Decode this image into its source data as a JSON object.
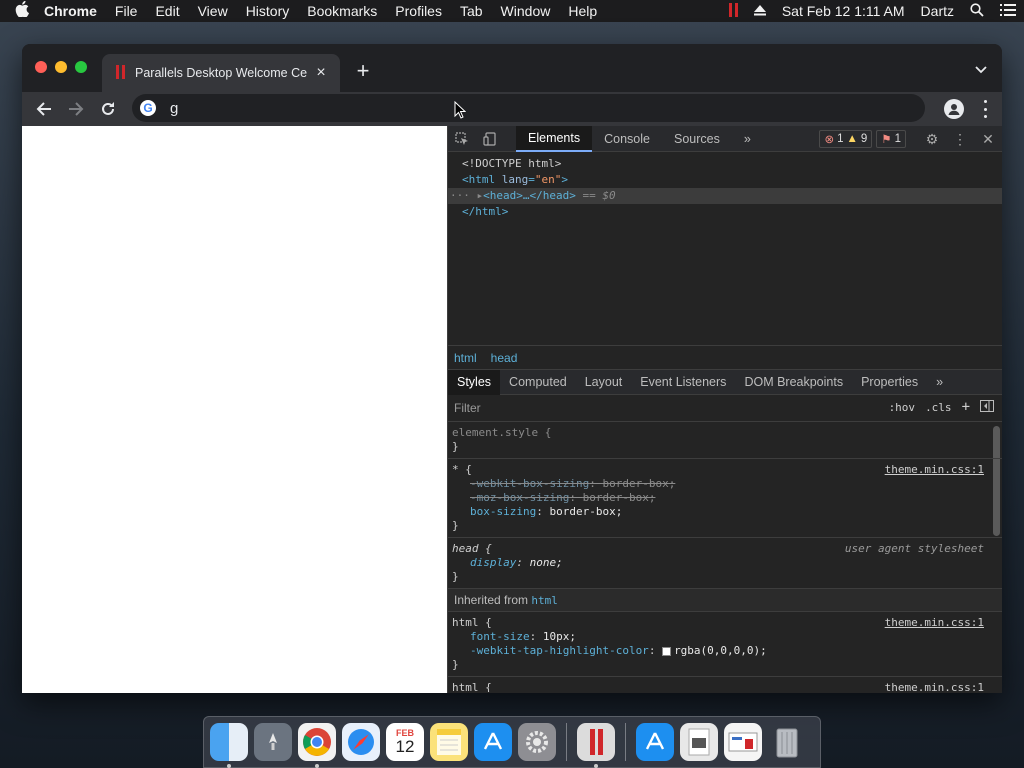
{
  "menubar": {
    "apple": "",
    "app": "Chrome",
    "items": [
      "File",
      "Edit",
      "View",
      "History",
      "Bookmarks",
      "Profiles",
      "Tab",
      "Window",
      "Help"
    ],
    "datetime": "Sat Feb 12  1:11 AM",
    "user": "Dartz"
  },
  "browser": {
    "tab_title": "Parallels Desktop Welcome Ce",
    "tab_close": "×",
    "new_tab": "+",
    "address_value": "g"
  },
  "devtools": {
    "tabs": [
      "Elements",
      "Console",
      "Sources"
    ],
    "more": "»",
    "errors": "1",
    "warnings": "9",
    "issues": "1",
    "dom": {
      "doctype": "<!DOCTYPE html>",
      "html_open_tag": "<html",
      "html_attr": "lang",
      "html_val": "\"en\"",
      "html_close": ">",
      "head_line": "<head>…</head>",
      "head_marker": "== $0",
      "html_end": "</html>"
    },
    "breadcrumbs": [
      "html",
      "head"
    ],
    "subtabs": [
      "Styles",
      "Computed",
      "Layout",
      "Event Listeners",
      "DOM Breakpoints",
      "Properties"
    ],
    "filter_placeholder": "Filter",
    "hov": ":hov",
    "cls": ".cls",
    "rules": {
      "element_style": "element.style {",
      "close": "}",
      "universal_selector": "* {",
      "universal_source": "theme.min.css:1",
      "webkit_bs_name": "-webkit-box-sizing",
      "webkit_bs_value": "border-box;",
      "moz_bs_name": "-moz-box-sizing",
      "moz_bs_value": "border-box;",
      "bs_name": "box-sizing",
      "bs_value": "border-box;",
      "head_selector": "head {",
      "head_source": "user agent stylesheet",
      "display_name": "display",
      "display_value": "none;",
      "inherited_label": "Inherited from",
      "inherited_tag": "html",
      "html_selector": "html {",
      "html_source": "theme.min.css:1",
      "fs_name": "font-size",
      "fs_value": "10px;",
      "tap_name": "-webkit-tap-highlight-color",
      "tap_value": "rgba(0,0,0,0);",
      "html_selector2": "html {",
      "html_source2": "theme.min.css:1"
    }
  },
  "dock": {
    "calendar_month": "FEB",
    "calendar_day": "12"
  }
}
